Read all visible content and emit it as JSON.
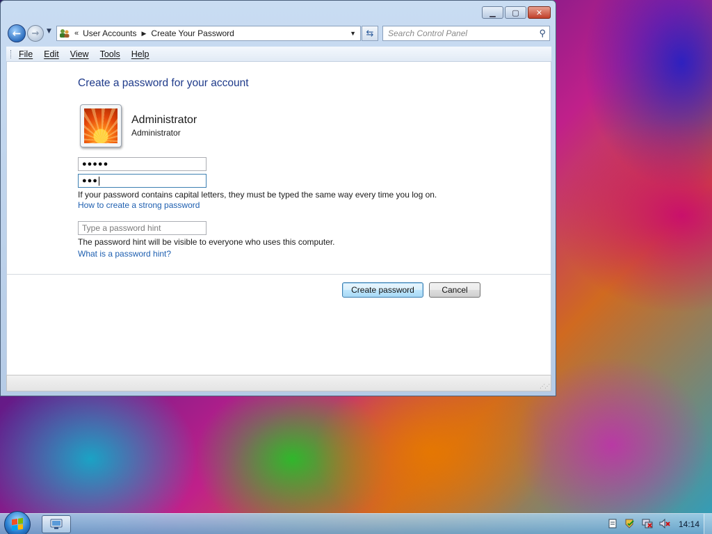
{
  "window": {
    "caption_buttons": [
      "minimize",
      "maximize",
      "close"
    ]
  },
  "address": {
    "overflow": "«",
    "crumbs": [
      "User Accounts",
      "Create Your Password"
    ],
    "search_placeholder": "Search Control Panel"
  },
  "menu": [
    "File",
    "Edit",
    "View",
    "Tools",
    "Help"
  ],
  "page": {
    "title": "Create a password for your account",
    "user_name": "Administrator",
    "user_type": "Administrator",
    "password_masked": "●●●●●",
    "confirm_masked": "●●●",
    "caps_note": "If your password contains capital letters, they must be typed the same way every time you log on.",
    "strong_link": "How to create a strong password",
    "hint_placeholder": "Type a password hint",
    "hint_note": "The password hint will be visible to everyone who uses this computer.",
    "hint_link": "What is a password hint?",
    "create_button": "Create password",
    "cancel_button": "Cancel"
  },
  "taskbar": {
    "clock": "14:14",
    "tray_icons": [
      "notes-icon",
      "action-center-icon",
      "network-icon",
      "volume-muted-icon"
    ]
  },
  "colors": {
    "title_blue": "#1e3a8a",
    "link_blue": "#1e5fb0",
    "focus_border": "#3c7fb1"
  }
}
